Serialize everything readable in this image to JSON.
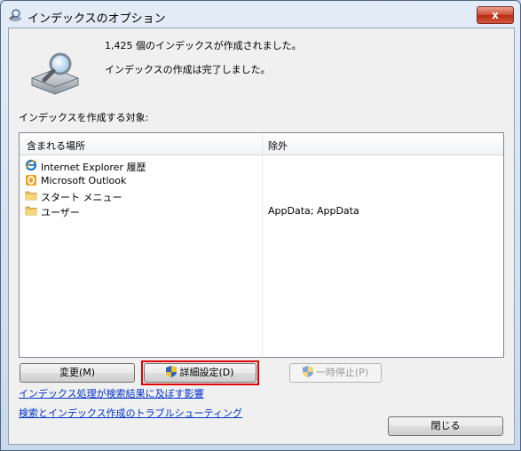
{
  "window": {
    "title": "インデックスのオプション",
    "close_glyph": "x"
  },
  "status": {
    "line1": "1,425 個のインデックスが作成されました。",
    "line2": "インデックスの作成は完了しました。"
  },
  "section_label": "インデックスを作成する対象:",
  "table": {
    "headers": {
      "included": "含まれる場所",
      "excluded": "除外"
    },
    "rows": [
      {
        "label": "Internet Explorer 履歴",
        "icon": "ie-icon",
        "excluded": ""
      },
      {
        "label": "Microsoft Outlook",
        "icon": "outlook-icon",
        "excluded": ""
      },
      {
        "label": "スタート メニュー",
        "icon": "folder-icon",
        "excluded": ""
      },
      {
        "label": "ユーザー",
        "icon": "folder-icon",
        "excluded": "AppData; AppData"
      }
    ]
  },
  "buttons": {
    "modify": "変更(M)",
    "advanced": "詳細設定(D)",
    "pause": "一時停止(P)",
    "close": "閉じる"
  },
  "links": {
    "impact": "インデックス処理が検索結果に及ぼす影響",
    "troubleshoot": "検索とインデックス作成のトラブルシューティング"
  },
  "colors": {
    "link": "#0033cc",
    "highlight": "#e00000"
  }
}
